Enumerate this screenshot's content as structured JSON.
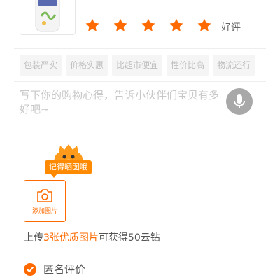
{
  "rating": {
    "stars_filled": 5,
    "stars_total": 5,
    "label": "好评",
    "star_color": "#ff6a00"
  },
  "tags": [
    "包装严实",
    "价格实惠",
    "比超市便宜",
    "性价比高",
    "物流还行"
  ],
  "review": {
    "placeholder": "写下你的购物心得，告诉小伙伴们宝贝有多好吧~",
    "mic_icon": "microphone-icon"
  },
  "photo": {
    "bubble": "记得晒图哦",
    "upload_label": "添加图片",
    "camera_icon": "camera-icon"
  },
  "reward": {
    "prefix": "上传",
    "highlight": "3张优质图片",
    "suffix": "可获得50云钻"
  },
  "anonymous": {
    "label": "匿名评价",
    "checked": true
  },
  "colors": {
    "accent": "#ff6a00",
    "mascot": "#ff8a00"
  }
}
